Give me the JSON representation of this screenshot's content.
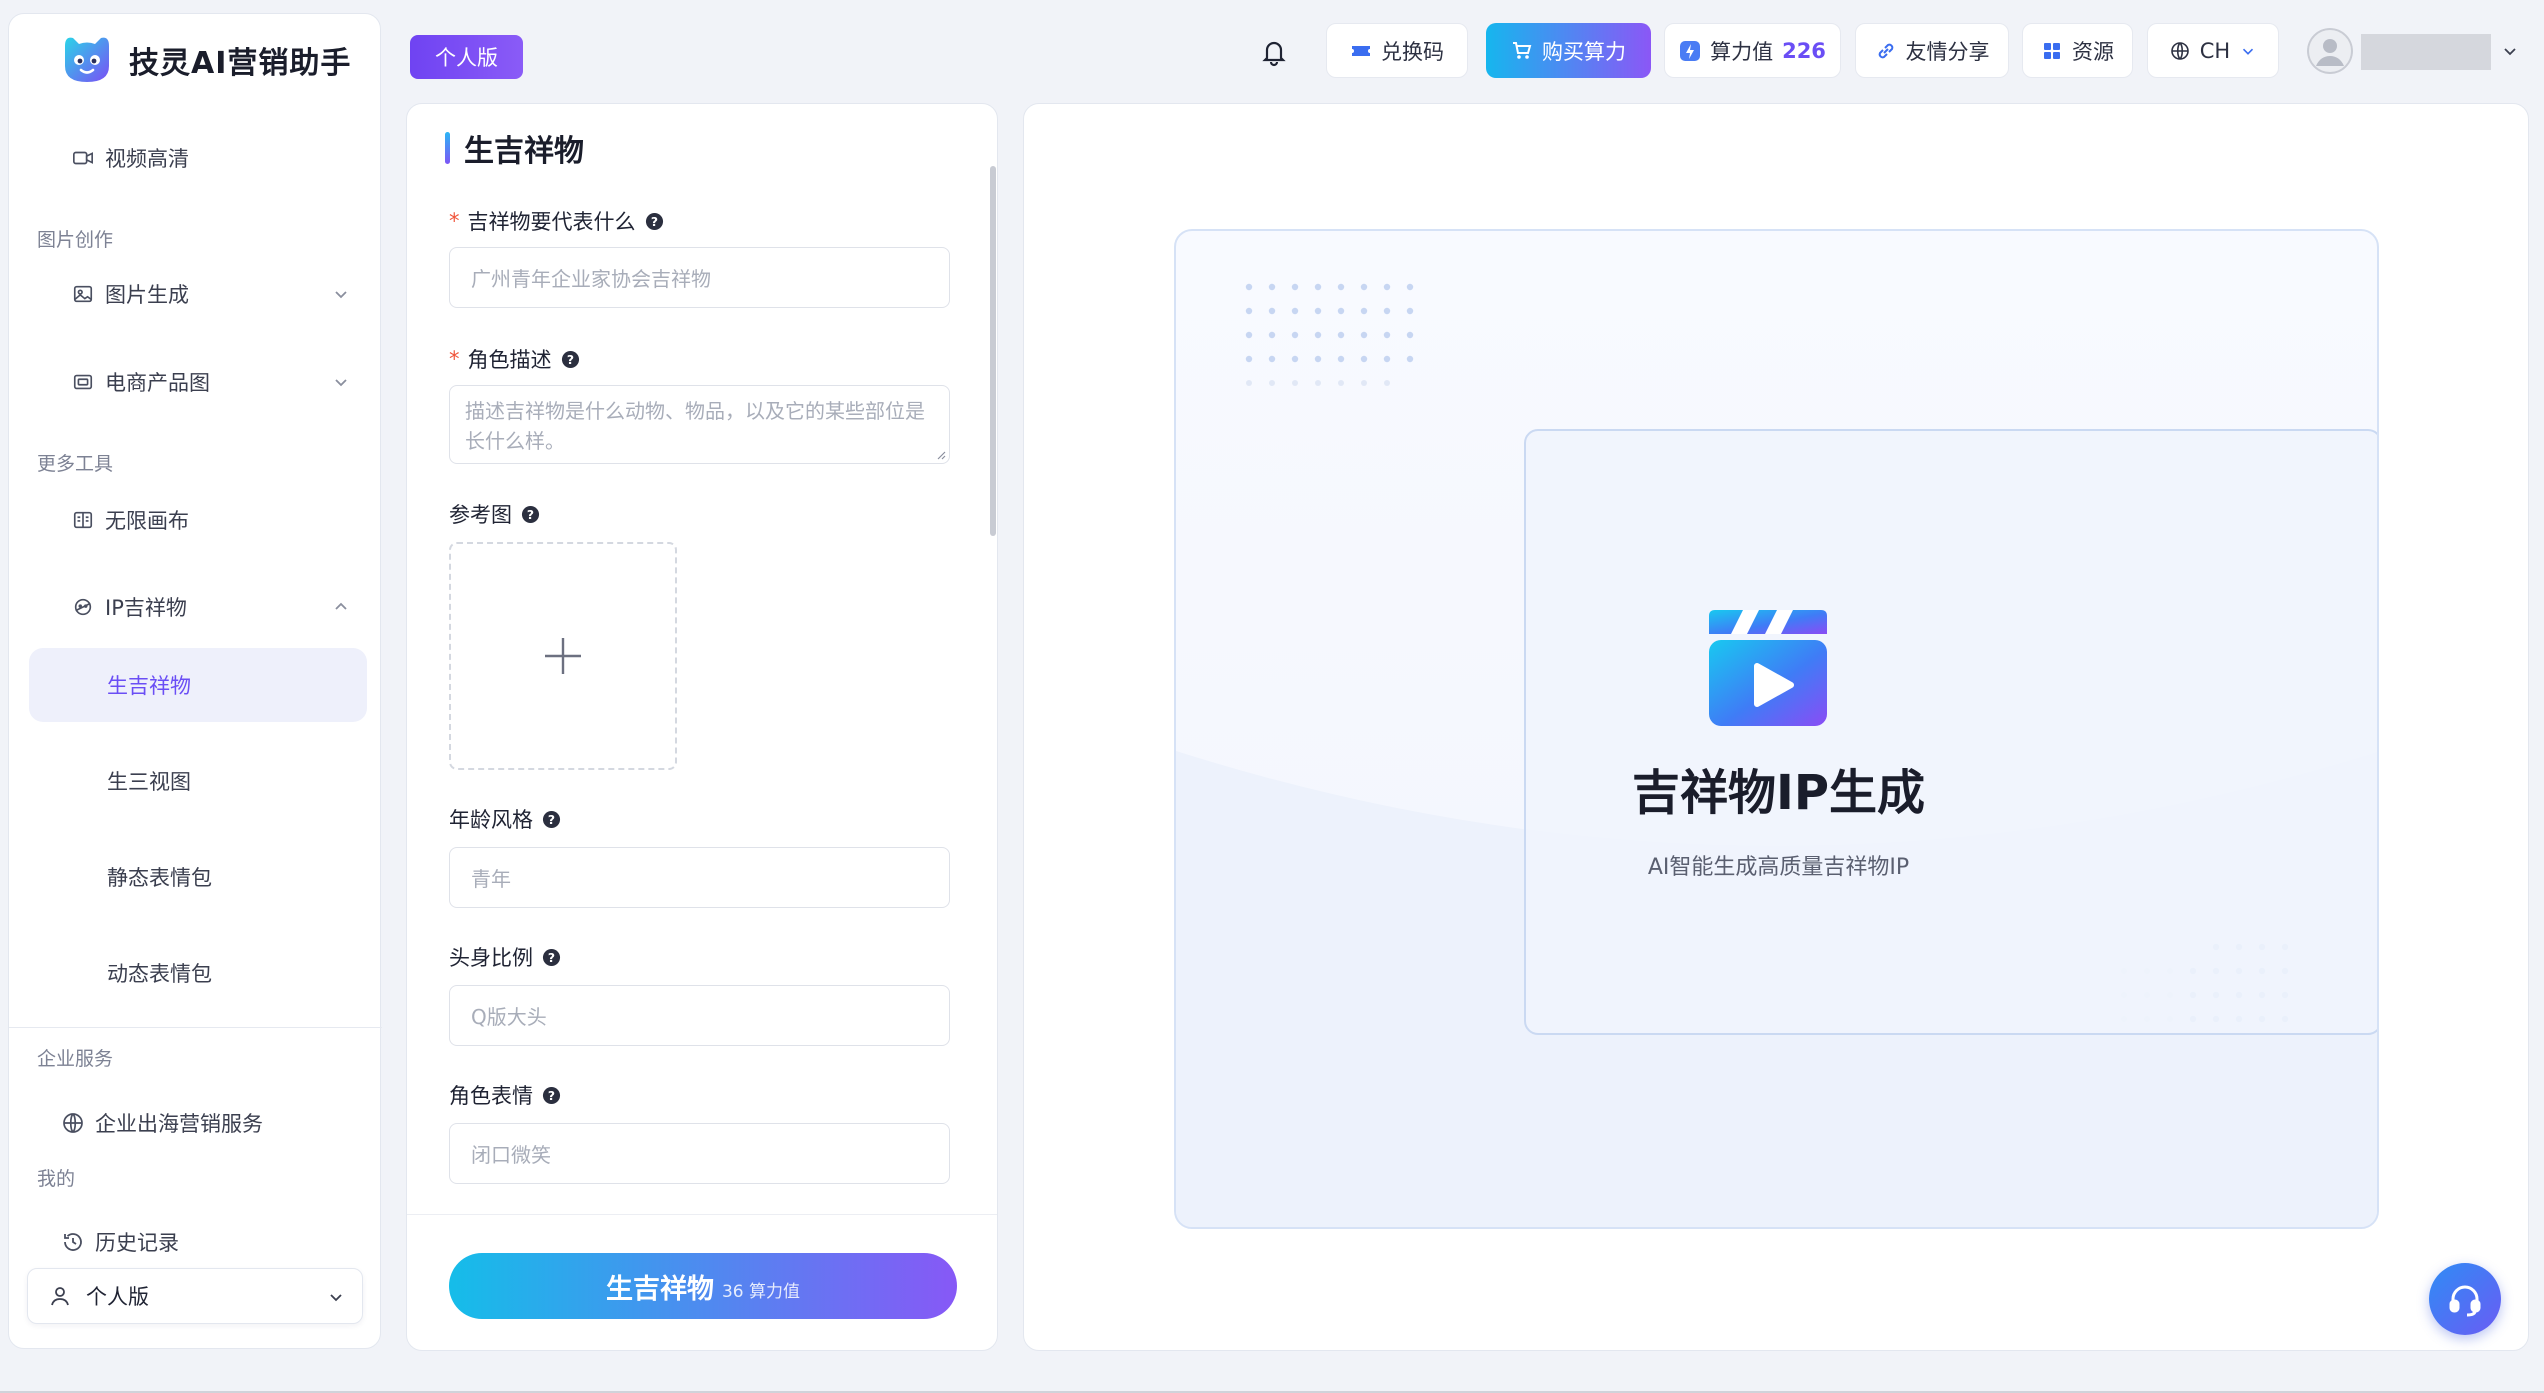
{
  "app": {
    "name": "技灵AI营销助手",
    "version_badge": "个人版"
  },
  "sidebar": {
    "video_hd": "视频高清",
    "section_image": "图片创作",
    "image_gen": "图片生成",
    "ecommerce": "电商产品图",
    "section_tools": "更多工具",
    "infinite_canvas": "无限画布",
    "ip_mascot": "IP吉祥物",
    "sub_items": [
      "生吉祥物",
      "生三视图",
      "静态表情包",
      "动态表情包"
    ],
    "section_enterprise": "企业服务",
    "overseas": "企业出海营销服务",
    "section_mine": "我的",
    "history": "历史记录",
    "version_select": "个人版"
  },
  "topbar": {
    "redeem": "兑换码",
    "buy_power": "购买算力",
    "power_label": "算力值",
    "power_value": "226",
    "share": "友情分享",
    "resources": "资源",
    "language": "CH"
  },
  "form": {
    "title": "生吉祥物",
    "represents_label": "吉祥物要代表什么",
    "represents_placeholder": "广州青年企业家协会吉祥物",
    "role_desc_label": "角色描述",
    "role_desc_placeholder": "描述吉祥物是什么动物、物品，以及它的某些部位是长什么样。",
    "reference_label": "参考图",
    "age_style_label": "年龄风格",
    "age_style_placeholder": "青年",
    "head_ratio_label": "头身比例",
    "head_ratio_placeholder": "Q版大头",
    "expression_label": "角色表情",
    "expression_placeholder": "闭口微笑",
    "generate_label": "生吉祥物",
    "generate_cost": "36 算力值"
  },
  "preview": {
    "title": "吉祥物IP生成",
    "subtitle": "AI智能生成高质量吉祥物IP"
  },
  "colors": {
    "accent": "#6a4ef5",
    "gradient_start": "#15bde9",
    "gradient_end": "#8758f6",
    "required": "#f0543a"
  }
}
